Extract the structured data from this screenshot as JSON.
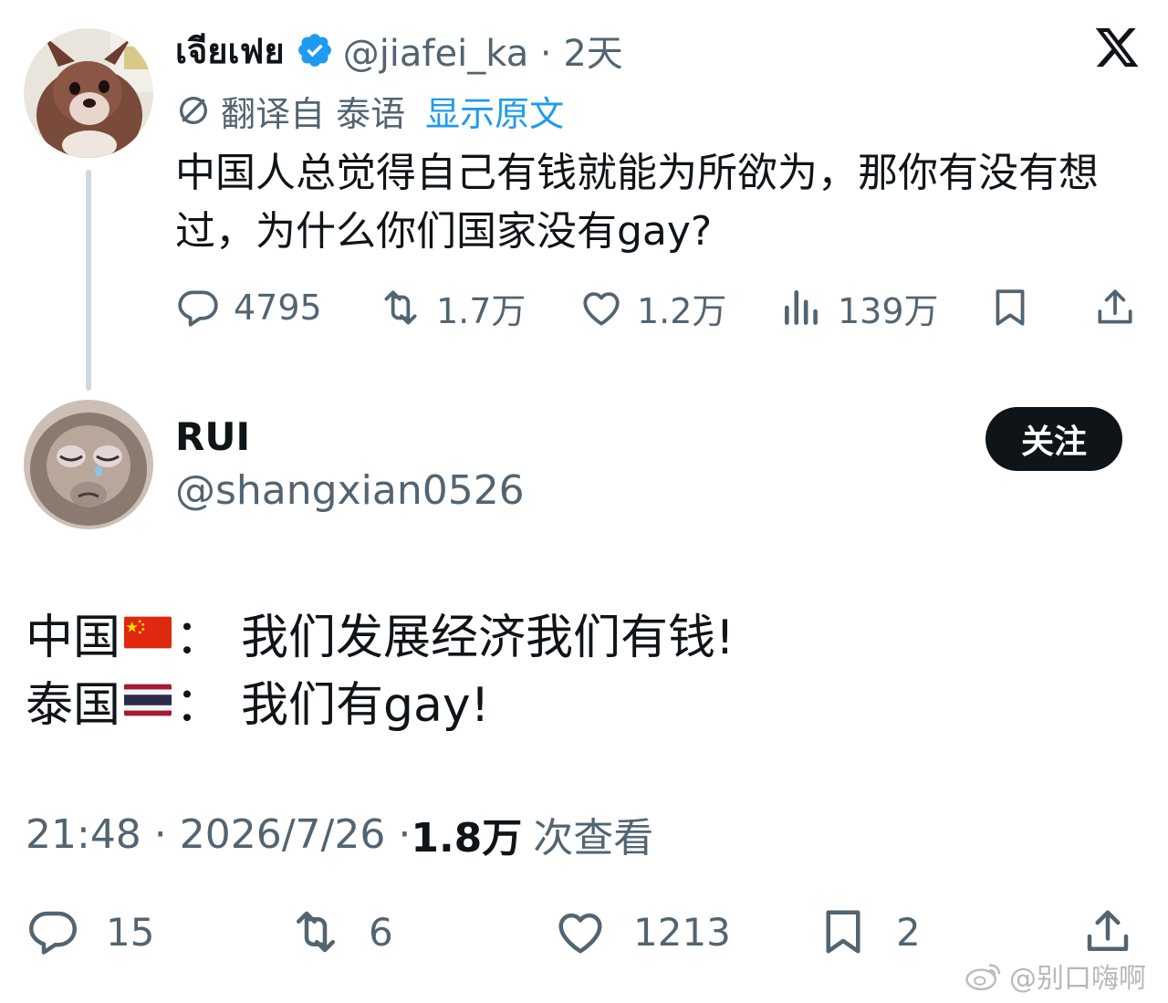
{
  "parent": {
    "display_name": "เจียเฟย",
    "handle_time": "@jiafei_ka · 2天",
    "translate_label": "翻译自 泰语",
    "show_original": "显示原文",
    "text": "中国人总觉得自己有钱就能为所欲为，那你有没有想过，为什么你们国家没有gay?",
    "stats": {
      "replies": "4795",
      "reposts": "1.7万",
      "likes": "1.2万",
      "views": "139万"
    }
  },
  "reply": {
    "display_name": "RUI",
    "handle": "@shangxian0526",
    "follow_label": "关注",
    "line1_country": "中国",
    "line1_sep": "：",
    "line1_text": "我们发展经济我们有钱!",
    "line2_country": "泰国",
    "line2_sep": "：",
    "line2_text": "我们有gay!",
    "time_date": "21:48 · 2026/7/26 · ",
    "views_count": "1.8万",
    "views_label": "次查看",
    "stats": {
      "replies": "15",
      "reposts": "6",
      "likes": "1213",
      "bookmarks": "2"
    }
  },
  "watermark": "@别口嗨啊",
  "icons": {
    "verified": "verified-badge-icon",
    "x_logo": "x-logo-icon",
    "translate": "translate-icon",
    "reply": "reply-icon",
    "repost": "repost-icon",
    "like": "like-icon",
    "views": "views-icon",
    "bookmark": "bookmark-icon",
    "share": "share-icon",
    "weibo": "weibo-icon"
  },
  "colors": {
    "text_primary": "#0f1419",
    "text_secondary": "#536471",
    "link_blue": "#1d9bf0",
    "verified_blue": "#1d9bf0",
    "follow_bg": "#0f1419",
    "thread_line": "#cfd9de"
  }
}
